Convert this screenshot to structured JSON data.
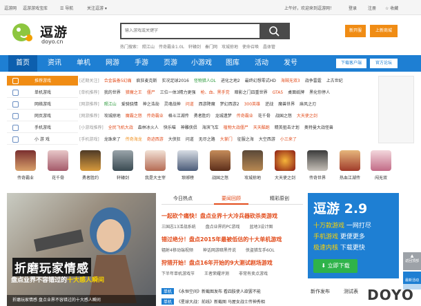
{
  "topbar": {
    "site": "逗游网",
    "subsite": "逗游游戏宝库",
    "nav_label": "导航",
    "follow": "关注逗游",
    "welcome": "上午好，欢迎来到逗游网！",
    "login": "登录",
    "register": "注册",
    "favorite": "收藏"
  },
  "header": {
    "logo_text": "逗游",
    "logo_sub": "doyo.cn",
    "search_placeholder": "输入游戏或关键字",
    "hot_label": "热门搜索：",
    "hot_words": [
      "陨江山",
      "传奇霸业1.0L",
      "轩辕剑",
      "秦门网",
      "攻城掠地",
      "使命召唤",
      "晶体管"
    ],
    "btn_kaifu": "新开服",
    "btn_mall": "上新商城"
  },
  "nav": {
    "items": [
      "首页",
      "资讯",
      "单机",
      "网游",
      "手游",
      "页游",
      "小游戏",
      "图库",
      "活动",
      "发号"
    ],
    "btn_client": "下载客户端",
    "btn_forum": "官方论坛"
  },
  "categories": [
    {
      "label": "推荐游戏",
      "icon": "star-icon"
    },
    {
      "label": "单机游戏",
      "icon": "gamepad-icon"
    },
    {
      "label": "网络游戏",
      "icon": "globe-icon"
    },
    {
      "label": "网页游戏",
      "icon": "browser-icon"
    },
    {
      "label": "手机游戏",
      "icon": "phone-icon"
    },
    {
      "label": "小 游 戏",
      "icon": "cursor-icon"
    }
  ],
  "rows": [
    {
      "tag": "[近期关注]",
      "items": [
        "合金装备5幻痛",
        "疯狂麦克斯",
        "实况足球2016",
        "怪物猎人OL",
        "进化之地2",
        "最终幻想零式HD",
        "海贼无双3",
        "战争雷霆",
        "上古世纪"
      ]
    },
    {
      "tag": "[单机推荐]",
      "items": [
        "我的世界",
        "猎魔之王",
        "僵尸",
        "三位一体3精力更强",
        "枪、血、黑手党",
        "暗影之门四重世界",
        "GTA5",
        "桌面纸牌",
        "黑化你停人"
      ]
    },
    {
      "tag": "[网游推荐]",
      "items": [
        "陨江山",
        "爱骑骁情",
        "神之浩劫",
        "灵魂战神",
        "问道",
        "西游降魔",
        "梦幻西游2",
        "300英雄",
        "逆战",
        "魔兽世界",
        "麻风之刃"
      ]
    },
    {
      "tag": "[网游推荐]",
      "items": [
        "攻城掠地",
        "魔霸之怒",
        "传奇霸业",
        "格斗江湖传",
        "勇者胜约",
        "龙城遗梦",
        "传奇霸业",
        "花千骨",
        "战国之怒",
        "大天使之剑"
      ]
    },
    {
      "tag": "[小游戏推荐]",
      "items": [
        "全民飞机大战",
        "森林冰火人",
        "快乐喵",
        "神雕侠侣",
        "海滨飞车",
        "植物大战僵尸",
        "天天酷跑",
        "精英狙击计划",
        "奥特曼大战怪兽"
      ]
    },
    {
      "tag": "[手机游戏]",
      "items": [
        "龙珠来了",
        "传奇海龙",
        "奇迹西游",
        "大侠狂",
        "问道",
        "无尽之路",
        "大掌门",
        "征服之海",
        "大空西游",
        "小三来了"
      ]
    }
  ],
  "game_icons": [
    "传奇霸业",
    "花千骨",
    "勇者胜约",
    "轩辕剑",
    "我是大主宰",
    "琅琊榜",
    "战国之怒",
    "攻城掠地",
    "大天使之剑",
    "传奇世界",
    "热血江湖传",
    "闯无双"
  ],
  "banner": {
    "title": "折磨玩家情感",
    "sub_pre": "盘点业界不容错过的",
    "sub_em": "十大感人瞬间",
    "caption": "折磨玩家情感 盘点业界不容错过的十大感人瞬间"
  },
  "news": {
    "tabs": [
      "今日热点",
      "要闻回顾",
      "精彩原创"
    ],
    "items": [
      {
        "title": "一起砍个痛快！盘点业界十大冷兵器砍杀类游戏",
        "subs": [
          "三国志13活战系统",
          "盘点业界的PC游戏",
          "盆地3设计图"
        ]
      },
      {
        "title": "错过绝分！盘点2015年最被低估的十大单机游戏",
        "subs": [
          "辐射4移动端视频",
          "神话网游暗黑传说",
          "侠盗猎车手6OL"
        ]
      },
      {
        "title": "狩猎开始！盘点16年开始的9大测试剧场游戏",
        "subs": [
          "下半年单机游戏节",
          "王者荣耀评测",
          "非常有卖点游戏"
        ]
      }
    ],
    "list": [
      {
        "badge": "单机",
        "text": "《永恒空间》新截图发布 看四肢使人欲罢不能"
      },
      {
        "badge": "单机",
        "text": "《星球大战：前线》新截图 马屋女战士传神秀相"
      }
    ]
  },
  "promo": {
    "brand": "逗游 2.9",
    "line1_em": "十万款游戏",
    "line1": "一网打尽",
    "line2_em": "手机游戏",
    "line2": "更便更多",
    "line3_em": "极速内核",
    "line3": "下载更快",
    "download": "立即下载"
  },
  "promo_tabs": [
    "新作发布",
    "测试表"
  ],
  "float": {
    "btn1": "最新活动",
    "btn2": "返回顶部"
  },
  "watermark": "DOYO"
}
